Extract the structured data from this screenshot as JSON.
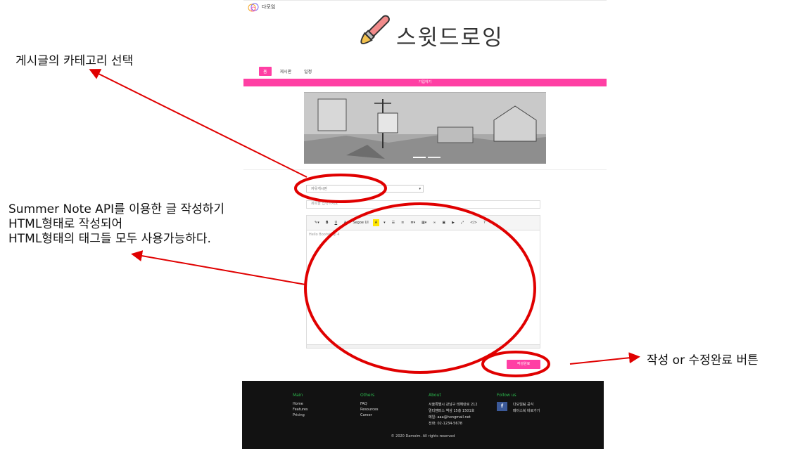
{
  "site": {
    "logo_text": "다모임",
    "title": "스윗드로잉"
  },
  "nav": [
    {
      "label": "홈"
    },
    {
      "label": "게시판"
    },
    {
      "label": "일정"
    }
  ],
  "signup_bar": "가입하기",
  "form": {
    "category_selected": "자유게시판",
    "title_placeholder": "제목을 입력하세요",
    "editor_placeholder": "Hello Bootstrap 4",
    "toolbar": {
      "font_name": "Segoe UI",
      "highlight_label": "A"
    },
    "submit_label": "작성완료"
  },
  "footer": {
    "main": {
      "heading": "Main",
      "items": [
        "Home",
        "Features",
        "Pricing"
      ]
    },
    "others": {
      "heading": "Others",
      "items": [
        "FAQ",
        "Resources",
        "Career"
      ]
    },
    "about": {
      "heading": "About",
      "items": [
        "서울특별시 강남구 테헤란로 212",
        "멀티캠퍼스 역삼 15층 1501호",
        "메일: aaa@hongmail.net",
        "전화: 02-1234-5678"
      ]
    },
    "follow": {
      "heading": "Follow us",
      "fb_letter": "f",
      "lines": [
        "다모임팀 공식",
        "페이스북 바로가기"
      ]
    },
    "copyright": "© 2020 Damoim. All rights reserved"
  },
  "annotations": {
    "category": "게시글의 카테고리 선택",
    "editor_lines": [
      "Summer Note API를 이용한 글 작성하기",
      "HTML형태로 작성되어",
      "HTML형태의 태그들 모두 사용가능하다."
    ],
    "submit": "작성 or 수정완료 버튼"
  },
  "colors": {
    "accent": "#ff3fa4",
    "annotation": "#e00000",
    "footer_bg": "#121212",
    "footer_heading": "#2dbb4e"
  }
}
